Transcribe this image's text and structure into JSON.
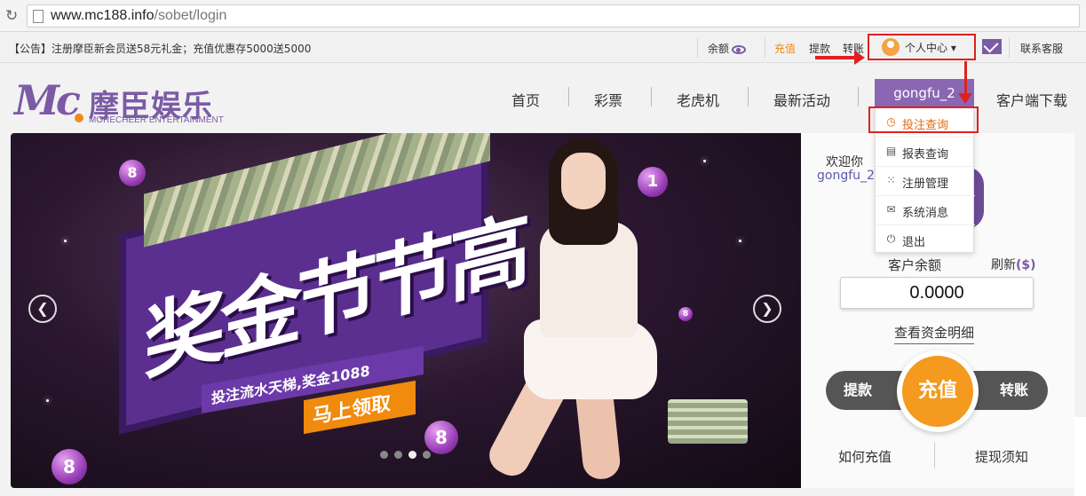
{
  "browser": {
    "url_host": "www.mc188.info",
    "url_path": "/sobet/login"
  },
  "topbar": {
    "notice": "【公告】注册摩臣新会员送58元礼金；充值优惠存5000送5000",
    "balance_label": "余额",
    "recharge": "充值",
    "withdraw": "提款",
    "transfer": "转账",
    "user_center": "个人中心",
    "service": "联系客服"
  },
  "logo": {
    "mark": "Mc",
    "name_cn": "摩臣娱乐",
    "name_en": "MORECHEER ENTERTAINMENT"
  },
  "nav": {
    "home": "首页",
    "lottery": "彩票",
    "slots": "老虎机",
    "events": "最新活动",
    "user": "gongfu_2",
    "download": "客户端下载"
  },
  "dropdown": {
    "items": [
      {
        "label": "投注查询",
        "icon": "clock-icon"
      },
      {
        "label": "报表查询",
        "icon": "report-icon"
      },
      {
        "label": "注册管理",
        "icon": "network-icon"
      },
      {
        "label": "系统消息",
        "icon": "mail-icon"
      },
      {
        "label": "退出",
        "icon": "power-icon"
      }
    ]
  },
  "banner": {
    "headline": "奖金节节高",
    "tagline": "投注流水天梯,奖金1088",
    "cta": "马上领取",
    "balls": [
      "8",
      "1",
      "8",
      "8",
      "8"
    ]
  },
  "panel": {
    "welcome": "欢迎你",
    "username": "gongfu_2",
    "balance_label": "客户余额",
    "refresh": "刷新",
    "balance": "0.0000",
    "details": "查看资金明细",
    "withdraw": "提款",
    "recharge": "充值",
    "transfer": "转账",
    "how_recharge": "如何充值",
    "how_withdraw": "提现须知"
  },
  "colors": {
    "brand_purple": "#7b5ba5",
    "accent_orange": "#f39a1f",
    "annotation_red": "#e02020"
  }
}
